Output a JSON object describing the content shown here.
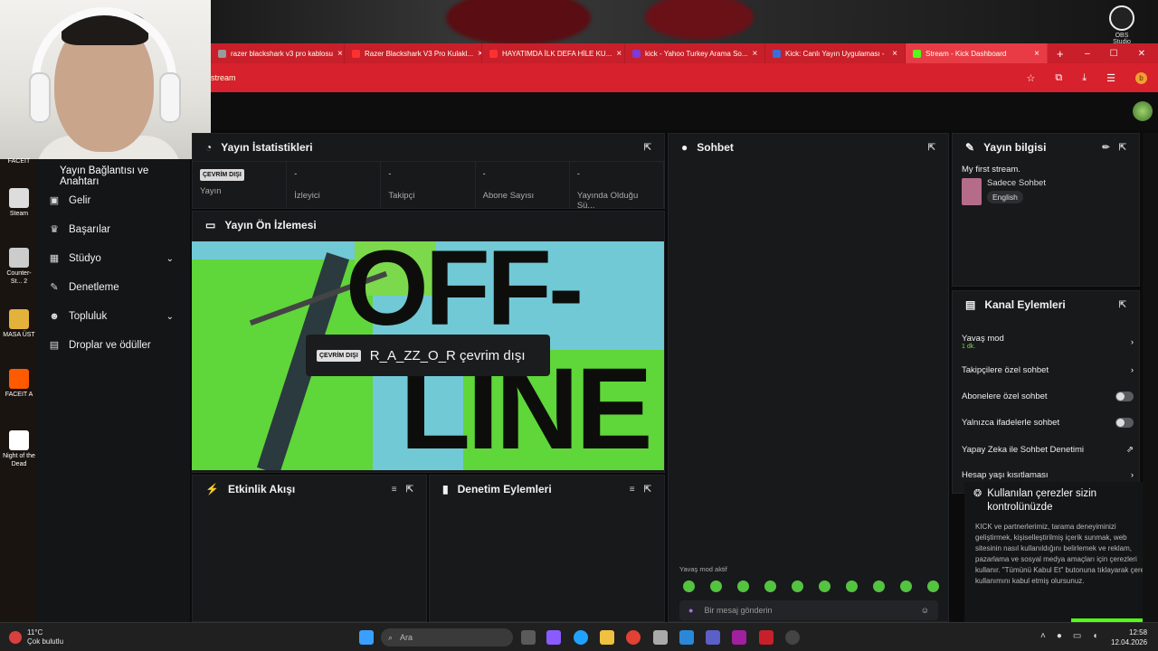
{
  "obs": {
    "label": "OBS Studio"
  },
  "tabs": [
    {
      "label": "razer blackshark v3 pro kablosu",
      "color": "#9a9a9a"
    },
    {
      "label": "Razer Blackshark V3 Pro Kulakl...",
      "color": "#ff3030"
    },
    {
      "label": "HAYATIMDA İLK DEFA HİLE KU...",
      "color": "#ff3030"
    },
    {
      "label": "kick - Yahoo Turkey Arama So...",
      "color": "#7b3bd8"
    },
    {
      "label": "Kick: Canlı Yayın Uygulaması -",
      "color": "#3a6ed8"
    },
    {
      "label": "Stream - Kick Dashboard",
      "color": "#53fc18"
    }
  ],
  "window_controls": {
    "minimize": "–",
    "maximize": "☐",
    "close": "✕"
  },
  "address": {
    "text": "stream",
    "account_initial": "b"
  },
  "desktop": [
    {
      "label": "FACEIT"
    },
    {
      "label": "Steam"
    },
    {
      "label": "Counter-St... 2"
    },
    {
      "label": "MASA ÜST"
    },
    {
      "label": "FACEIT A"
    },
    {
      "label": "Night of the Dead"
    }
  ],
  "sidebar": {
    "header": "Yayın Bağlantısı ve Anahtarı",
    "items": [
      {
        "label": "Gelir",
        "icon": "wallet-icon"
      },
      {
        "label": "Başarılar",
        "icon": "trophy-icon"
      },
      {
        "label": "Stüdyo",
        "icon": "studio-icon",
        "expandable": true
      },
      {
        "label": "Denetleme",
        "icon": "wrench-icon"
      },
      {
        "label": "Topluluk",
        "icon": "community-icon",
        "expandable": true
      },
      {
        "label": "Droplar ve ödüller",
        "icon": "drops-icon"
      }
    ]
  },
  "stats_panel": {
    "title": "Yayın İstatistikleri",
    "badge": "ÇEVRİM DIŞI",
    "stats": [
      {
        "label": "Yayın",
        "value": ""
      },
      {
        "label": "İzleyici",
        "value": "-"
      },
      {
        "label": "Takipçi",
        "value": "-"
      },
      {
        "label": "Abone Sayısı",
        "value": "-"
      },
      {
        "label": "Yayında Olduğu Sü...",
        "value": "-"
      }
    ]
  },
  "preview_panel": {
    "title": "Yayın Ön İzlemesi",
    "badge": "ÇEVRİM DIŞI",
    "channel_status": "R_A_ZZ_O_R çevrim dışı",
    "art_text_top": "OFF-",
    "art_text_bottom": "LINE"
  },
  "activity_panel": {
    "title": "Etkinlik Akışı"
  },
  "moderation_panel": {
    "title": "Denetim Eylemleri"
  },
  "chat_panel": {
    "title": "Sohbet",
    "slow_mode": "Yavaş mod aktif",
    "placeholder": "Bir mesaj gönderin"
  },
  "info_panel": {
    "title": "Yayın bilgisi",
    "stream_title": "My first stream.",
    "category": "Sadece Sohbet",
    "language": "English"
  },
  "actions_panel": {
    "title": "Kanal Eylemleri",
    "rows": [
      {
        "label": "Yavaş mod",
        "sub": "1 dk.",
        "control": "chevron"
      },
      {
        "label": "Takipçilere özel sohbet",
        "control": "chevron"
      },
      {
        "label": "Abonelere özel sohbet",
        "control": "toggle"
      },
      {
        "label": "Yalnızca ifadelerle sohbet",
        "control": "toggle"
      },
      {
        "label": "Yapay Zeka ile Sohbet Denetimi",
        "control": "external"
      },
      {
        "label": "Hesap yaşı kısıtlaması",
        "control": "chevron"
      }
    ]
  },
  "cookie": {
    "title": "Kullanılan çerezler sizin kontrolünüzde",
    "body": "KICK ve partnerlerimiz, tarama deneyiminizi geliştirmek, kişiselleştirilmiş içerik sunmak, web sitesinin nasıl kullanıldığını belirlemek ve reklam, pazarlama ve sosyal medya amaçları için çerezleri kullanır. \"Tümünü Kabul Et\" butonuna tıklayarak çerez kullanımını kabul etmiş olursunuz."
  },
  "taskbar": {
    "weather_temp": "11°C",
    "weather_desc": "Çok bulutlu",
    "search_placeholder": "Ara",
    "time": "12:58",
    "date": "12.04.2026"
  }
}
